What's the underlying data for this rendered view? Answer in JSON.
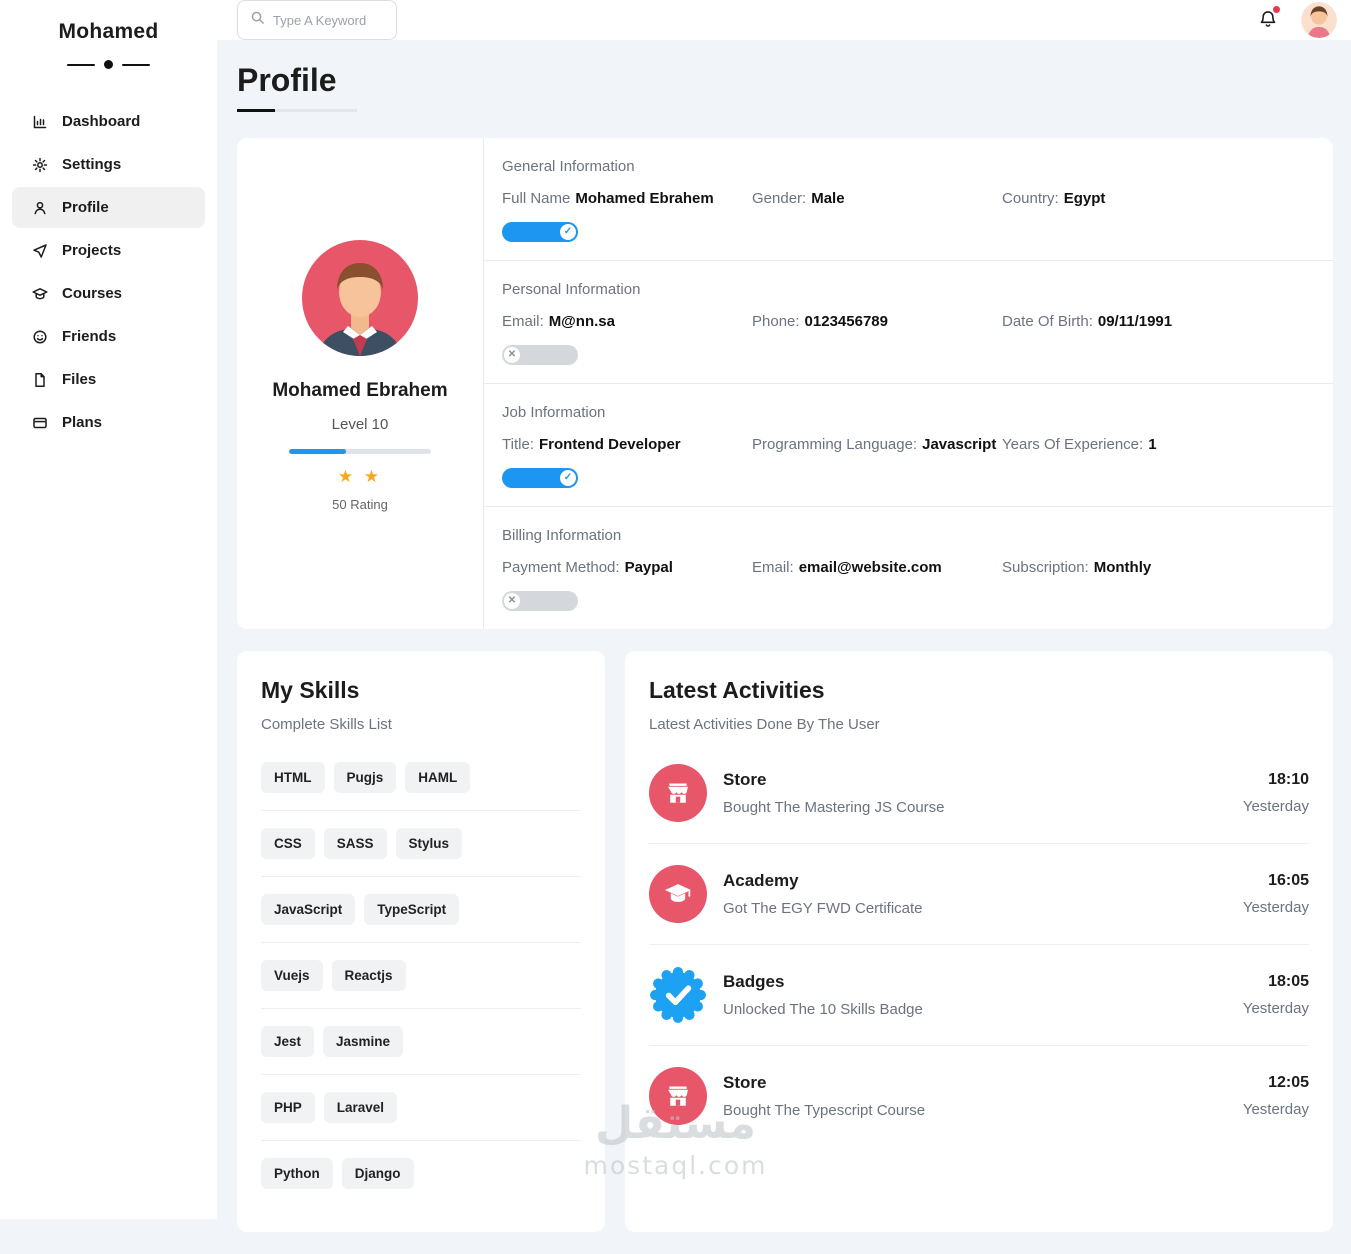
{
  "sidebar": {
    "brand": "Mohamed",
    "items": [
      {
        "label": "Dashboard",
        "icon": "dashboard-icon"
      },
      {
        "label": "Settings",
        "icon": "settings-icon"
      },
      {
        "label": "Profile",
        "icon": "profile-icon",
        "active": true
      },
      {
        "label": "Projects",
        "icon": "projects-icon"
      },
      {
        "label": "Courses",
        "icon": "courses-icon"
      },
      {
        "label": "Friends",
        "icon": "friends-icon"
      },
      {
        "label": "Files",
        "icon": "files-icon"
      },
      {
        "label": "Plans",
        "icon": "plans-icon"
      }
    ]
  },
  "topbar": {
    "search_placeholder": "Type A Keyword",
    "notification_dot": true
  },
  "page": {
    "title": "Profile"
  },
  "profile": {
    "name": "Mohamed Ebrahem",
    "level": "Level 10",
    "progress_percent": 40,
    "stars_display": "★ ★",
    "stars_count": 2,
    "rating": "50 Rating",
    "sections": [
      {
        "title": "General Information",
        "toggle_on": true,
        "fields": [
          {
            "label": "Full Name",
            "value": "Mohamed Ebrahem"
          },
          {
            "label": "Gender:",
            "value": "Male"
          },
          {
            "label": "Country:",
            "value": "Egypt"
          }
        ]
      },
      {
        "title": "Personal Information",
        "toggle_on": false,
        "fields": [
          {
            "label": "Email:",
            "value": "M@nn.sa"
          },
          {
            "label": "Phone:",
            "value": "0123456789"
          },
          {
            "label": "Date Of Birth:",
            "value": "09/11/1991"
          }
        ]
      },
      {
        "title": "Job Information",
        "toggle_on": true,
        "fields": [
          {
            "label": "Title:",
            "value": "Frontend Developer"
          },
          {
            "label": "Programming Language:",
            "value": "Javascript"
          },
          {
            "label": "Years Of Experience:",
            "value": "1"
          }
        ]
      },
      {
        "title": "Billing Information",
        "toggle_on": false,
        "fields": [
          {
            "label": "Payment Method:",
            "value": "Paypal"
          },
          {
            "label": "Email:",
            "value": "email@website.com"
          },
          {
            "label": "Subscription:",
            "value": "Monthly"
          }
        ]
      }
    ]
  },
  "skills": {
    "title": "My Skills",
    "subtitle": "Complete Skills List",
    "rows": [
      [
        "HTML",
        "Pugjs",
        "HAML"
      ],
      [
        "CSS",
        "SASS",
        "Stylus"
      ],
      [
        "JavaScript",
        "TypeScript"
      ],
      [
        "Vuejs",
        "Reactjs"
      ],
      [
        "Jest",
        "Jasmine"
      ],
      [
        "PHP",
        "Laravel"
      ],
      [
        "Python",
        "Django"
      ]
    ]
  },
  "activities": {
    "title": "Latest Activities",
    "subtitle": "Latest Activities Done By The User",
    "items": [
      {
        "icon": "store-icon",
        "title": "Store",
        "desc": "Bought The Mastering JS Course",
        "time": "18:10",
        "day": "Yesterday"
      },
      {
        "icon": "academy-icon",
        "title": "Academy",
        "desc": "Got The EGY FWD Certificate",
        "time": "16:05",
        "day": "Yesterday"
      },
      {
        "icon": "badge-icon",
        "title": "Badges",
        "desc": "Unlocked The 10 Skills Badge",
        "time": "18:05",
        "day": "Yesterday"
      },
      {
        "icon": "store-icon",
        "title": "Store",
        "desc": "Bought The Typescript Course",
        "time": "12:05",
        "day": "Yesterday"
      }
    ]
  },
  "ui": {
    "check": "✓",
    "cross": "✕"
  },
  "colors": {
    "accent_blue": "#1d96f2",
    "icon_red": "#e8566a",
    "badge_blue": "#1da1f2",
    "star_orange": "#f5a81c",
    "notification_red": "#e8384f"
  },
  "watermark": {
    "line1": "مستقل",
    "line2": "mostaql.com"
  }
}
